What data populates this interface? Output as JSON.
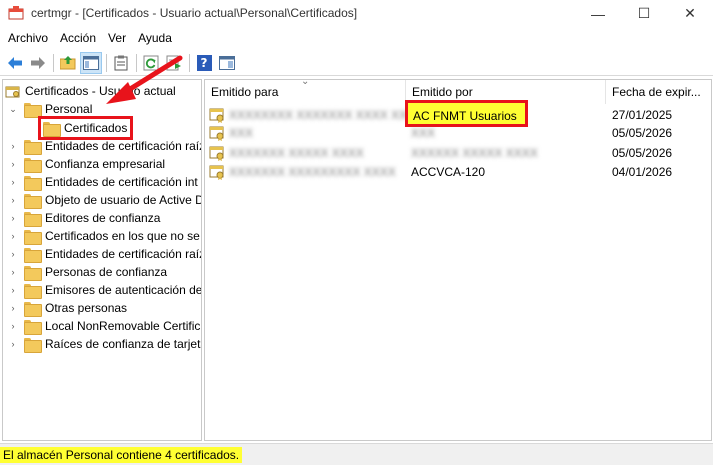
{
  "window": {
    "title": "certmgr - [Certificados - Usuario actual\\Personal\\Certificados]",
    "minimize_glyph": "—",
    "maximize_glyph": "☐",
    "close_glyph": "✕"
  },
  "menu": {
    "items": [
      "Archivo",
      "Acción",
      "Ver",
      "Ayuda"
    ]
  },
  "toolbar": {
    "icons": [
      "back-arrow-icon",
      "forward-arrow-icon",
      "up-folder-icon",
      "show-hide-tree-icon",
      "properties-icon",
      "refresh-icon",
      "export-list-icon",
      "help-icon",
      "console-view-icon"
    ],
    "help_glyph": "?"
  },
  "tree": {
    "root": "Certificados - Usuario actual",
    "personal": "Personal",
    "selected": "Certificados",
    "items": [
      "Entidades de certificación raíz",
      "Confianza empresarial",
      "Entidades de certificación int",
      "Objeto de usuario de Active D",
      "Editores de confianza",
      "Certificados en los que no se",
      "Entidades de certificación raíz",
      "Personas de confianza",
      "Emisores de autenticación de",
      "Otras personas",
      "Local NonRemovable Certific",
      "Raíces de confianza de tarjeta"
    ]
  },
  "list": {
    "columns": [
      "Emitido para",
      "Emitido por",
      "Fecha de expir..."
    ],
    "sort_indicator": "⌄",
    "rows": [
      {
        "issued_to": "XXXXXXXX XXXXXXX XXXX XXX",
        "issued_by": "AC FNMT Usuarios",
        "expires": "27/01/2025"
      },
      {
        "issued_to": "XXX",
        "issued_by": "XXX",
        "expires": "05/05/2026"
      },
      {
        "issued_to": "XXXXXXX XXXXX XXXX",
        "issued_by": "XXXXXX XXXXX XXXX",
        "expires": "05/05/2026"
      },
      {
        "issued_to": "XXXXXXX XXXXXXXXX XXXX",
        "issued_by": "ACCVCA-120",
        "expires": "04/01/2026"
      }
    ]
  },
  "status": {
    "text": "El almacén Personal contiene 4 certificados."
  },
  "colors": {
    "highlight_yellow": "#ffff33",
    "annotation_red": "#e8131b",
    "folder_yellow": "#f3c95c"
  }
}
